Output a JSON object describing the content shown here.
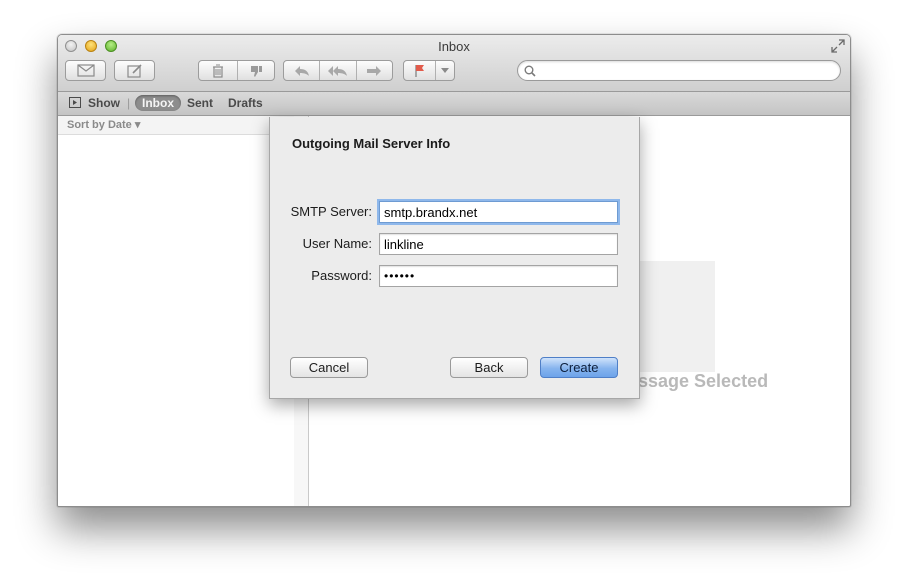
{
  "window": {
    "title": "Inbox"
  },
  "toolbar": {
    "search": {
      "value": "",
      "placeholder": ""
    }
  },
  "favorites": {
    "show_label": "Show",
    "items": [
      {
        "label": "Inbox",
        "selected": true
      },
      {
        "label": "Sent"
      },
      {
        "label": "Drafts"
      }
    ]
  },
  "message_list": {
    "sort_label": "Sort by Date ▾"
  },
  "viewer": {
    "empty_text": "No Message Selected"
  },
  "dialog": {
    "title": "Outgoing Mail Server Info",
    "smtp_label": "SMTP Server:",
    "smtp_value": "smtp.brandx.net",
    "user_label": "User Name:",
    "user_value": "linkline",
    "password_label": "Password:",
    "password_value": "••••••",
    "cancel_label": "Cancel",
    "back_label": "Back",
    "create_label": "Create"
  },
  "colors": {
    "accent": "#6da3ea",
    "focus_ring": "#8fb8eb"
  }
}
